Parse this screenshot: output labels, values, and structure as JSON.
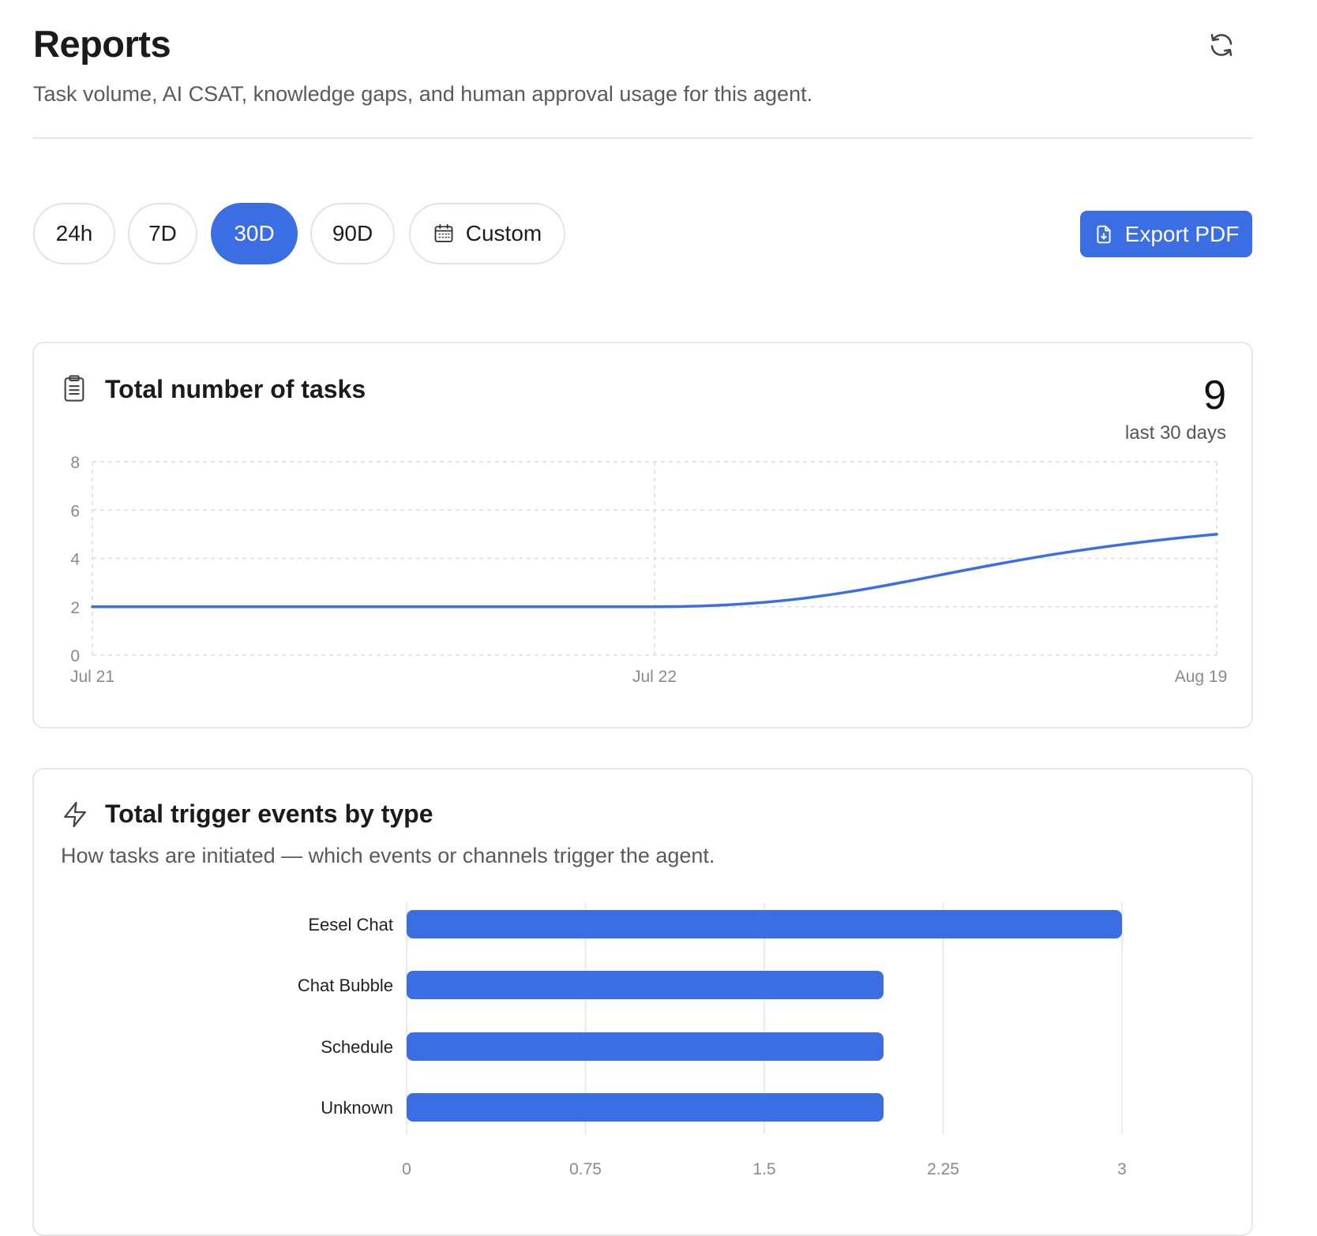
{
  "header": {
    "title": "Reports",
    "subtitle": "Task volume, AI CSAT, knowledge gaps, and human approval usage for this agent."
  },
  "toolbar": {
    "ranges": [
      {
        "label": "24h",
        "active": false
      },
      {
        "label": "7D",
        "active": false
      },
      {
        "label": "30D",
        "active": true
      },
      {
        "label": "90D",
        "active": false
      },
      {
        "label": "Custom",
        "active": false,
        "icon": "calendar-icon"
      }
    ],
    "export_label": "Export PDF",
    "export_icon": "file-download-icon",
    "refresh_icon": "refresh-icon"
  },
  "colors": {
    "accent": "#3b6de3",
    "grid": "#dcdcdc",
    "axis_text": "#8a8a8a"
  },
  "tasks_card": {
    "icon": "clipboard-icon",
    "title": "Total number of tasks",
    "total": "9",
    "total_caption": "last 30 days"
  },
  "triggers_card": {
    "icon": "lightning-icon",
    "title": "Total trigger events by type",
    "description": "How tasks are initiated — which events or channels trigger the agent."
  },
  "chart_data": [
    {
      "type": "line",
      "x": [
        "Jul 21",
        "Jul 22",
        "Aug 19"
      ],
      "values": [
        2,
        2,
        5
      ],
      "ylim": [
        0,
        8
      ],
      "yticks": [
        0,
        2,
        4,
        6,
        8
      ],
      "grid": true
    },
    {
      "type": "bar",
      "orientation": "horizontal",
      "categories": [
        "Eesel Chat",
        "Chat Bubble",
        "Schedule",
        "Unknown"
      ],
      "values": [
        3,
        2,
        2,
        2
      ],
      "xlim": [
        0,
        3
      ],
      "xticks": [
        "0",
        "0.75",
        "1.5",
        "2.25",
        "3"
      ],
      "grid": true
    }
  ]
}
